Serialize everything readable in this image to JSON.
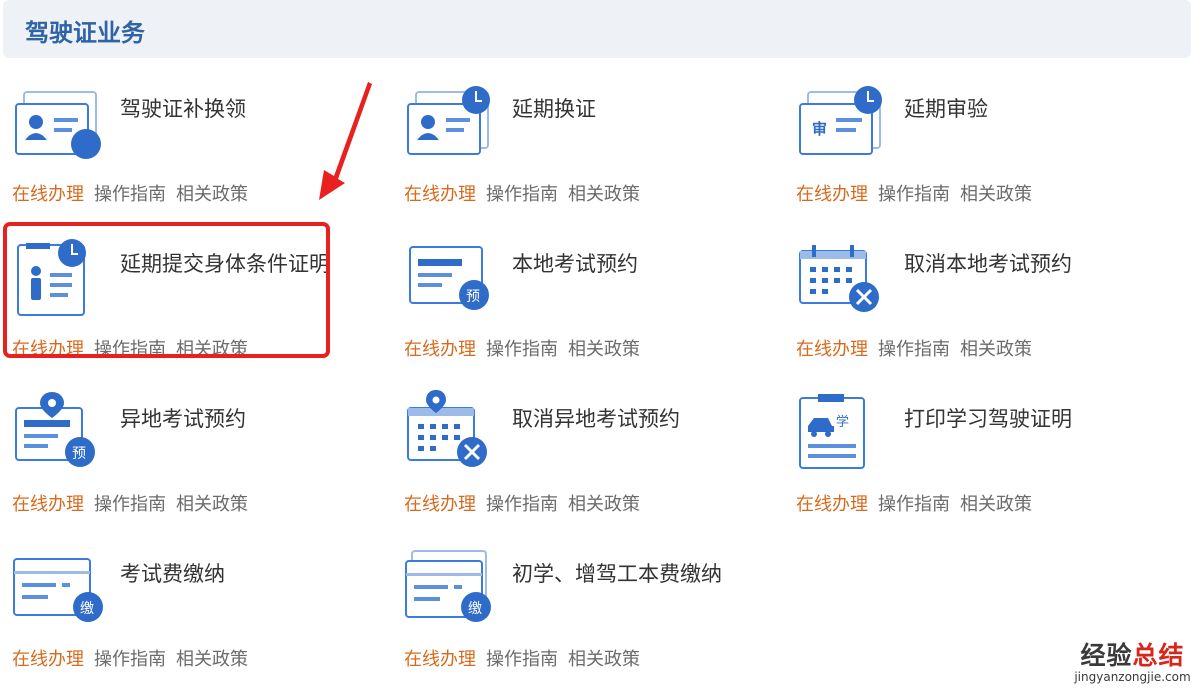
{
  "header": {
    "title": "驾驶证业务"
  },
  "links": {
    "online": "在线办理",
    "guide": "操作指南",
    "policy": "相关政策"
  },
  "services": [
    {
      "name": "驾驶证补换领",
      "icon": "license-replace-icon"
    },
    {
      "name": "延期换证",
      "icon": "extend-renewal-icon"
    },
    {
      "name": "延期审验",
      "icon": "extend-audit-icon",
      "badge": "审"
    },
    {
      "name": "延期提交身体条件证明",
      "icon": "extend-health-proof-icon"
    },
    {
      "name": "本地考试预约",
      "icon": "local-exam-booking-icon",
      "badge": "预"
    },
    {
      "name": "取消本地考试预约",
      "icon": "cancel-local-exam-icon"
    },
    {
      "name": "异地考试预约",
      "icon": "remote-exam-booking-icon",
      "badge": "预"
    },
    {
      "name": "取消异地考试预约",
      "icon": "cancel-remote-exam-icon"
    },
    {
      "name": "打印学习驾驶证明",
      "icon": "print-learner-permit-icon",
      "badge": "学"
    },
    {
      "name": "考试费缴纳",
      "icon": "exam-fee-payment-icon",
      "badge": "缴"
    },
    {
      "name": "初学、增驾工本费缴纳",
      "icon": "beginner-fee-payment-icon",
      "badge": "缴"
    }
  ],
  "watermark": {
    "cn_prefix": "经验",
    "cn_suffix": "总结",
    "en": "jingyanzongjie.com"
  },
  "colors": {
    "accent": "#2e63a6",
    "icon_blue": "#3b7be0",
    "online_link": "#d86a1e",
    "highlight": "#e8201f"
  }
}
